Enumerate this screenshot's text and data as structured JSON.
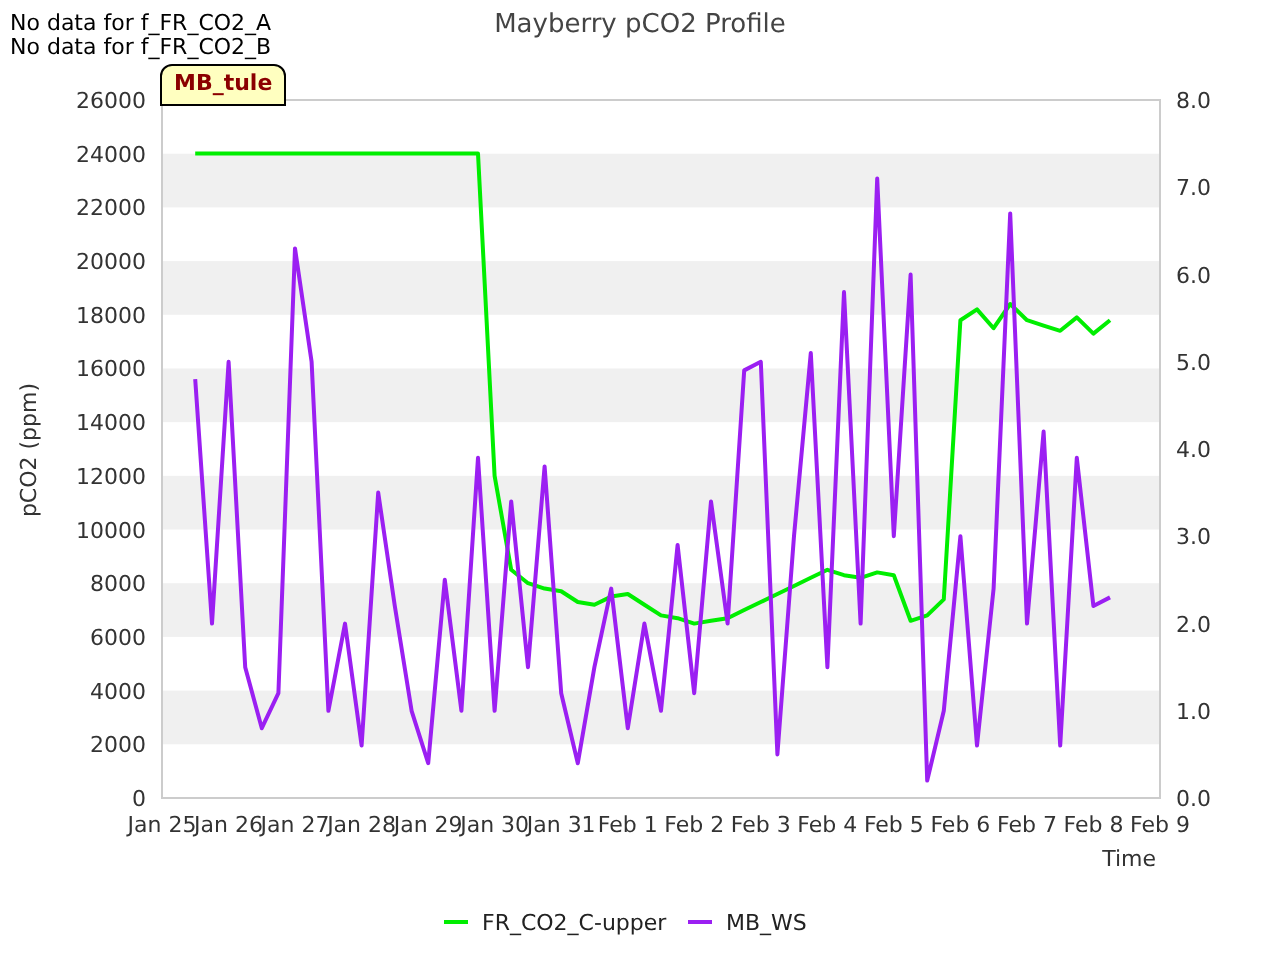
{
  "notes": [
    "No data for f_FR_CO2_A",
    "No data for f_FR_CO2_B"
  ],
  "tag": "MB_tule",
  "chart_data": {
    "type": "line",
    "title": "Mayberry pCO2 Profile",
    "xlabel": "Time",
    "ylabel": "pCO2 (ppm)",
    "categories": [
      "Jan 25",
      null,
      null,
      null,
      "Jan 26",
      null,
      null,
      null,
      "Jan 27",
      null,
      null,
      null,
      "Jan 28",
      null,
      null,
      null,
      "Jan 29",
      null,
      null,
      null,
      "Jan 30",
      null,
      null,
      null,
      "Jan 31",
      null,
      null,
      null,
      "Feb 1",
      null,
      null,
      null,
      "Feb 2",
      null,
      null,
      null,
      "Feb 3",
      null,
      null,
      null,
      "Feb 4",
      null,
      null,
      null,
      "Feb 5",
      null,
      null,
      null,
      "Feb 6",
      null,
      null,
      null,
      "Feb 7",
      null,
      null,
      null,
      "Feb 8",
      null,
      null,
      null,
      "Feb 9"
    ],
    "series": [
      {
        "name": "FR_CO2_C-upper",
        "color": "#00ee00",
        "axis": "y",
        "values": [
          null,
          null,
          24000,
          24000,
          24000,
          24000,
          24000,
          24000,
          24000,
          24000,
          24000,
          24000,
          24000,
          24000,
          24000,
          24000,
          24000,
          24000,
          24000,
          24000,
          12000,
          8500,
          8000,
          7800,
          7700,
          7300,
          7200,
          7500,
          7600,
          7200,
          6800,
          6700,
          6500,
          6600,
          6700,
          7000,
          7300,
          7600,
          7900,
          8200,
          8500,
          8300,
          8200,
          8400,
          8300,
          6600,
          6800,
          7400,
          17800,
          18200,
          17500,
          18400,
          17800,
          17600,
          17400,
          17900,
          17300,
          17800,
          null,
          null,
          null
        ]
      },
      {
        "name": "MB_WS",
        "color": "#9b1ff2",
        "axis": "y2",
        "values": [
          null,
          null,
          4.8,
          2.0,
          5.0,
          1.5,
          0.8,
          1.2,
          6.3,
          5.0,
          1.0,
          2.0,
          0.6,
          3.5,
          2.2,
          1.0,
          0.4,
          2.5,
          1.0,
          3.9,
          1.0,
          3.4,
          1.5,
          3.8,
          1.2,
          0.4,
          1.5,
          2.4,
          0.8,
          2.0,
          1.0,
          2.9,
          1.2,
          3.4,
          2.0,
          4.9,
          5.0,
          0.5,
          3.0,
          5.1,
          1.5,
          5.8,
          2.0,
          7.1,
          3.0,
          6.0,
          0.2,
          1.0,
          3.0,
          0.6,
          2.4,
          6.7,
          2.0,
          4.2,
          0.6,
          3.9,
          2.2,
          2.3,
          null,
          null,
          null
        ]
      }
    ],
    "legend": "bottom",
    "ylim": [
      0,
      26000
    ],
    "y2lim": [
      0,
      8
    ],
    "yticks": [
      0,
      2000,
      4000,
      6000,
      8000,
      10000,
      12000,
      14000,
      16000,
      18000,
      20000,
      22000,
      24000,
      26000
    ],
    "y2ticks": [
      {
        "value": 0,
        "label": "0.0"
      },
      {
        "value": 1,
        "label": "1.0"
      },
      {
        "value": 2,
        "label": "2.0"
      },
      {
        "value": 3,
        "label": "3.0"
      },
      {
        "value": 4,
        "label": "4.0"
      },
      {
        "value": 5,
        "label": "5.0"
      },
      {
        "value": 6,
        "label": "6.0"
      },
      {
        "value": 7,
        "label": "7.0"
      },
      {
        "value": 8,
        "label": "8.0"
      }
    ]
  }
}
